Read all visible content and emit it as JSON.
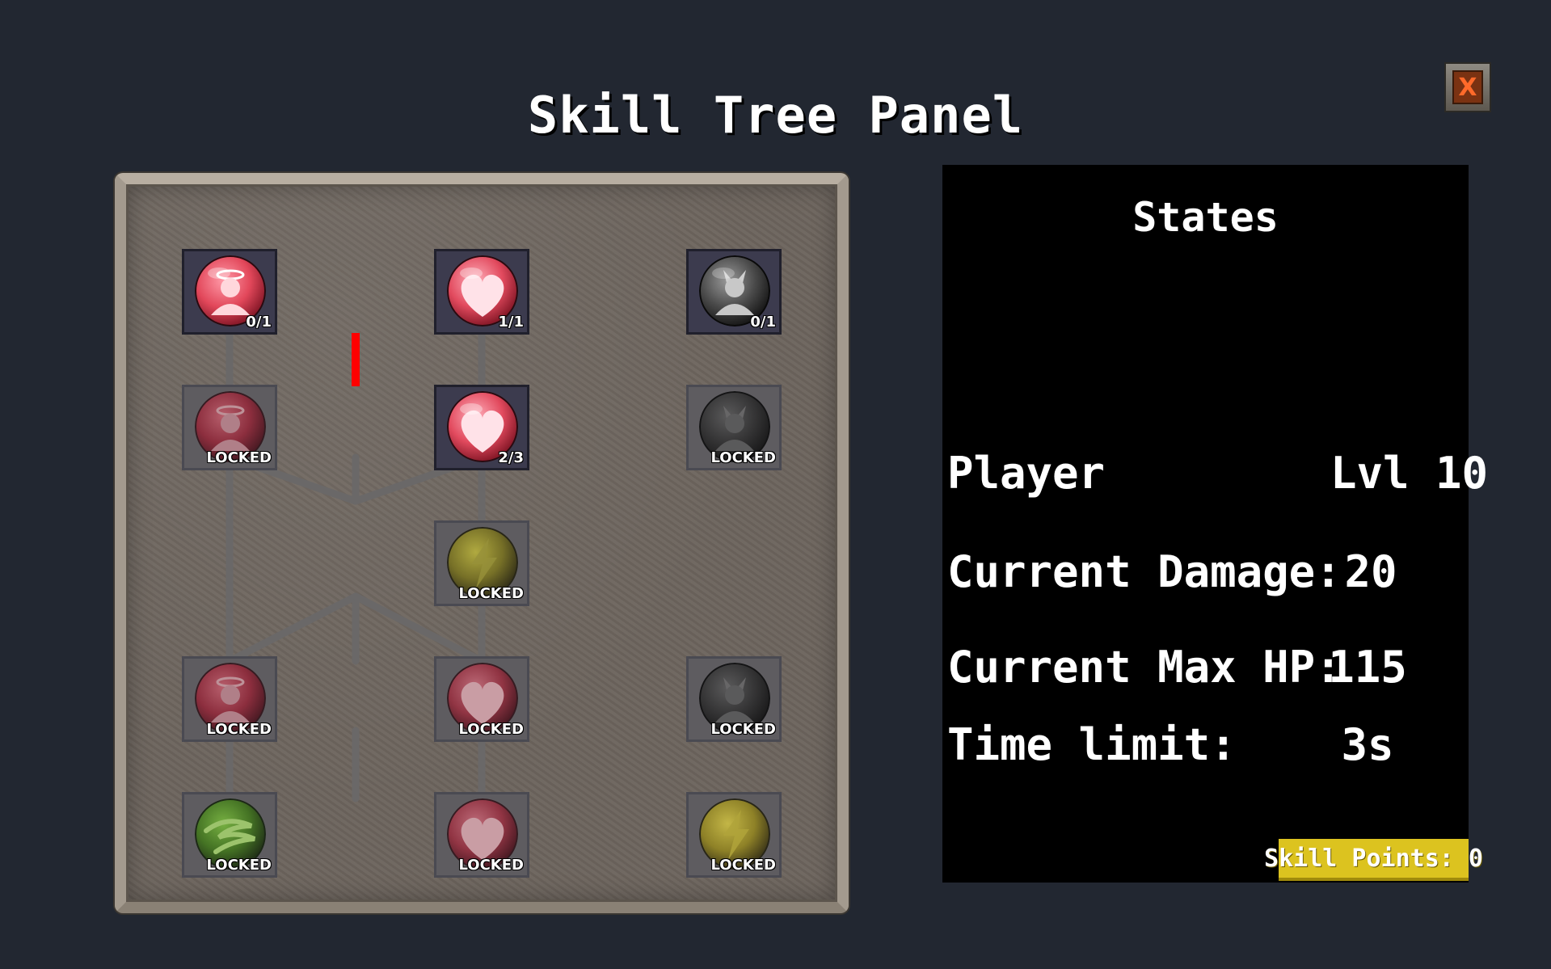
{
  "title": "Skill Tree Panel",
  "close_label": "X",
  "colors": {
    "background": "#222731",
    "active_link": "#ff0000",
    "inactive_link": "#6a6868",
    "skill_points_bg": "#dcc31f"
  },
  "nodes": [
    {
      "id": "angel-1",
      "icon": "angel-icon",
      "status": "0/1",
      "state": "unlocked"
    },
    {
      "id": "heart-1",
      "icon": "heart-icon",
      "status": "1/1",
      "state": "unlocked"
    },
    {
      "id": "demon-1",
      "icon": "demon-icon",
      "status": "0/1",
      "state": "unlocked"
    },
    {
      "id": "angel-2",
      "icon": "angel-icon",
      "status": "LOCKED",
      "state": "locked"
    },
    {
      "id": "heart-2",
      "icon": "heart-icon",
      "status": "2/3",
      "state": "unlocked"
    },
    {
      "id": "demon-2",
      "icon": "demon-icon",
      "status": "LOCKED",
      "state": "locked"
    },
    {
      "id": "lightning-1",
      "icon": "lightning-icon",
      "status": "LOCKED",
      "state": "locked"
    },
    {
      "id": "angel-3",
      "icon": "angel-icon",
      "status": "LOCKED",
      "state": "locked"
    },
    {
      "id": "heart-3",
      "icon": "heart-icon",
      "status": "LOCKED",
      "state": "locked"
    },
    {
      "id": "demon-3",
      "icon": "demon-icon",
      "status": "LOCKED",
      "state": "locked"
    },
    {
      "id": "wind-1",
      "icon": "wind-icon",
      "status": "LOCKED",
      "state": "locked"
    },
    {
      "id": "heart-4",
      "icon": "heart-icon",
      "status": "LOCKED",
      "state": "locked"
    },
    {
      "id": "lightning-2",
      "icon": "lightning-icon",
      "status": "LOCKED",
      "state": "locked"
    }
  ],
  "stats": {
    "heading": "States",
    "player_label": "Player",
    "player_level": "Lvl 10",
    "damage_label": "Current Damage:",
    "damage_value": "20",
    "hp_label": "Current Max HP:",
    "hp_value": "115",
    "time_label": "Time limit:",
    "time_value": "3s",
    "skill_points": "Skill Points: 0"
  }
}
